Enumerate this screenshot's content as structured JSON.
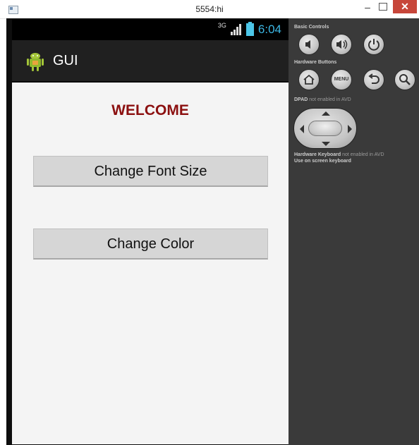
{
  "window": {
    "title": "5554:hi",
    "minimize_glyph": "–",
    "close_glyph": "✕"
  },
  "statusbar": {
    "network": "3G",
    "time": "6:04"
  },
  "actionbar": {
    "app_icon": "android-icon",
    "title": "GUI"
  },
  "content": {
    "welcome": "WELCOME",
    "welcome_color": "#8b0f0f",
    "buttons": [
      {
        "label": "Change Font Size"
      },
      {
        "label": "Change Color"
      }
    ]
  },
  "controls": {
    "basic_controls_label": "Basic Controls",
    "basic_controls": [
      "volume-down-icon",
      "volume-up-icon",
      "power-icon"
    ],
    "hardware_buttons_label": "Hardware Buttons",
    "hardware_buttons": [
      "home-icon",
      "menu-button",
      "back-icon",
      "search-icon"
    ],
    "menu_label": "MENU",
    "dpad_label": "DPAD",
    "dpad_note": "not enabled in AVD",
    "keyboard_label": "Hardware Keyboard",
    "keyboard_note": "not enabled in AVD",
    "keyboard_hint": "Use on screen keyboard"
  }
}
